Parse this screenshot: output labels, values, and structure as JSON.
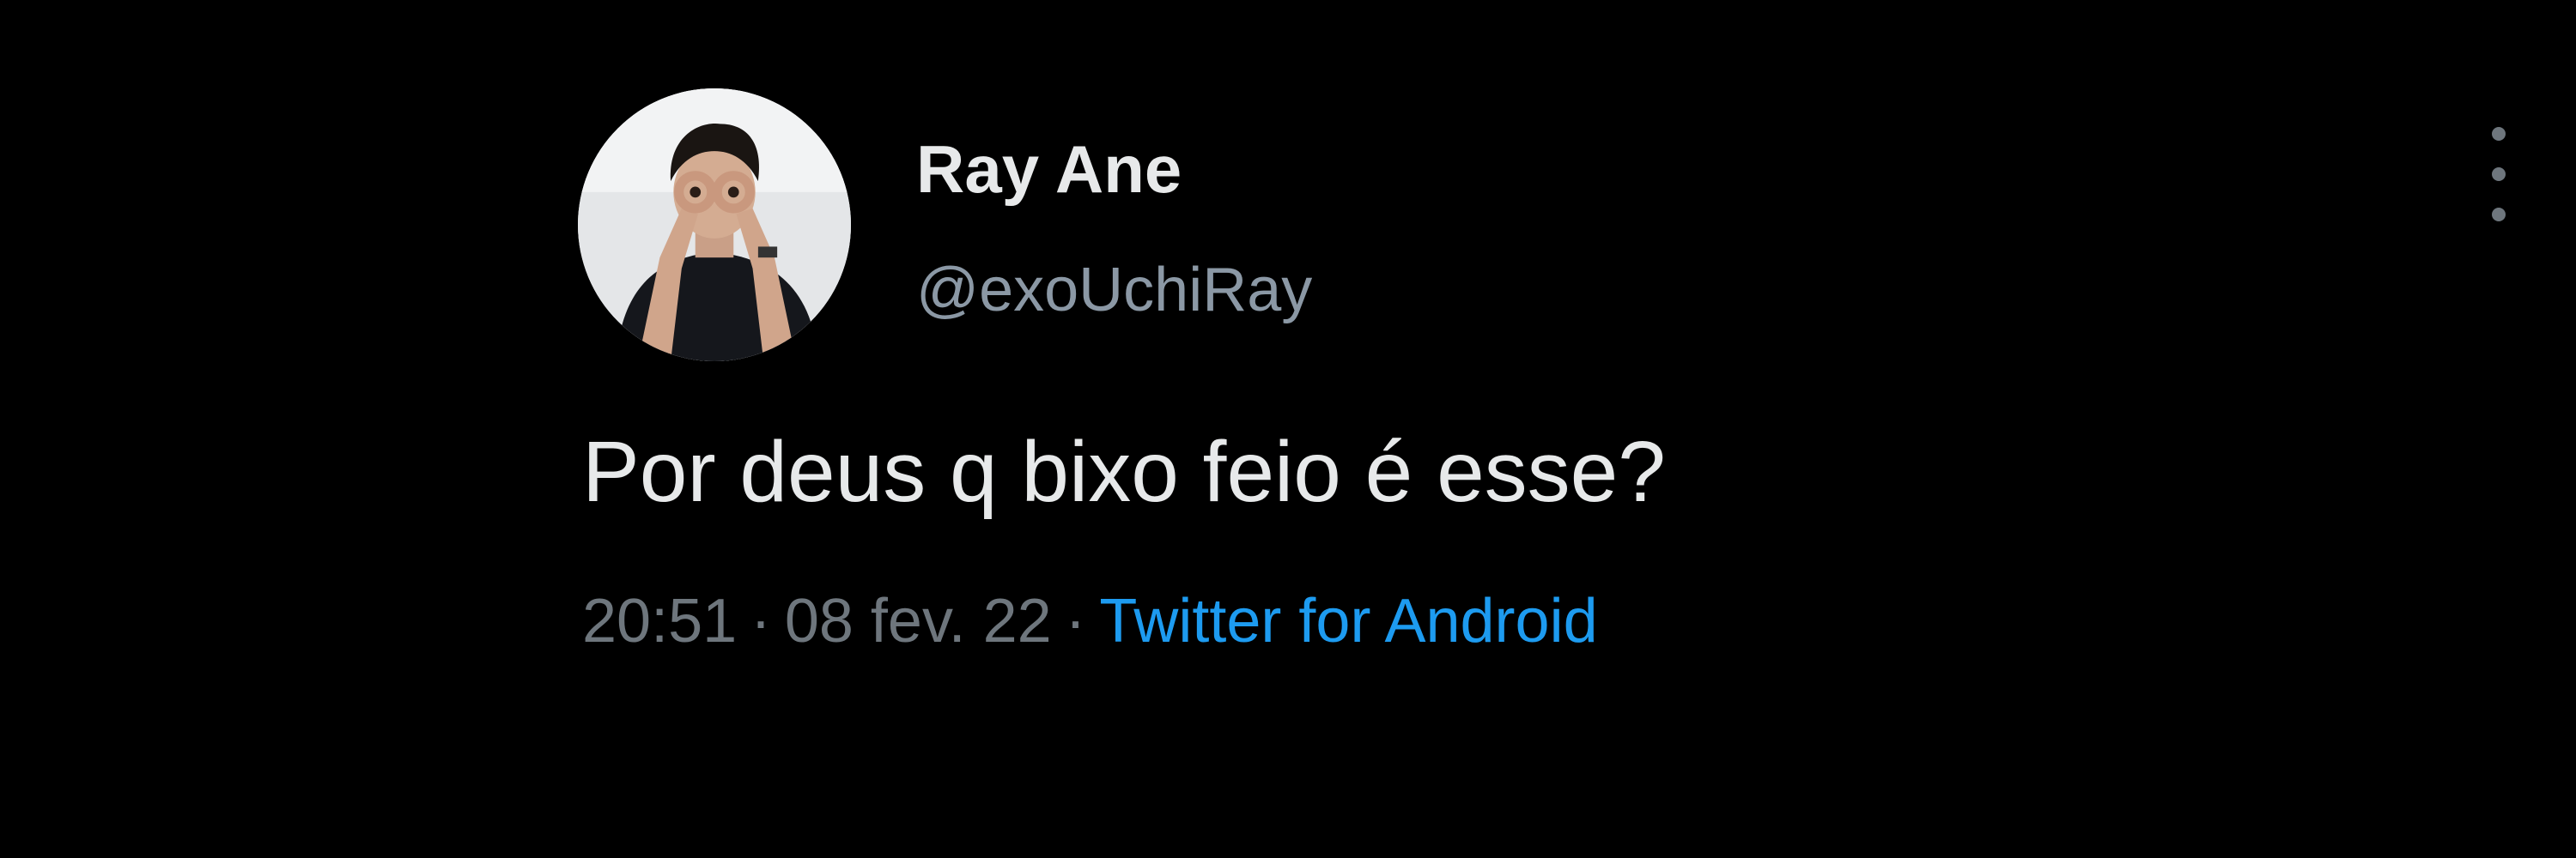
{
  "tweet": {
    "author": {
      "display_name": "Ray Ane",
      "handle": "@exoUchiRay",
      "avatar_icon": "user-photo-avatar"
    },
    "more_icon": "vertical-ellipsis-icon",
    "text": "Por deus q bixo feio é esse?",
    "time": "20:51",
    "separator": "·",
    "date": "08 fev. 22",
    "source": "Twitter for Android"
  },
  "colors": {
    "background": "#000000",
    "primary_text": "#e7e9ea",
    "secondary_text": "#6e767d",
    "link": "#1d9bf0"
  }
}
